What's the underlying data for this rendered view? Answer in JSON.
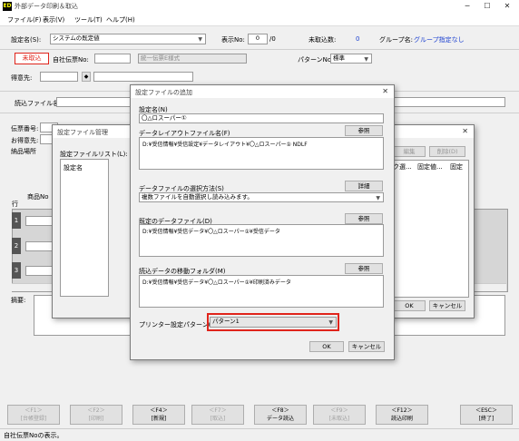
{
  "window": {
    "title": "外部データ印刷＆取込",
    "app_icon": "ED",
    "min": "─",
    "max": "☐",
    "close": "✕"
  },
  "menu": [
    "ファイル(F)",
    "表示(V)",
    "ツール(T)",
    "ヘルプ(H)"
  ],
  "main": {
    "setting_name_label": "設定名(S):",
    "setting_name_value": "システムの既定値",
    "display_no_label": "表示No:",
    "display_no_value": "0",
    "display_no_total": "/0",
    "unimported_label": "未取込数:",
    "unimported_value": "0",
    "group_label": "グループ名:",
    "group_value": "グループ指定なし",
    "status_badge": "未取込",
    "company_slip_label": "自社伝票No:",
    "slip_type_value": "統一伝票E様式",
    "pattern_label": "パターンNo:",
    "pattern_value": "標準",
    "customer_label": "得意先:",
    "customer_search_symbol": "◆",
    "read_file_label": "読込ファイル名:",
    "slip_no_label": "伝票番号:",
    "customer2_label": "お得意先:",
    "delivery_label": "納品場所",
    "row_label": "行",
    "product_label": "商品No",
    "rows": [
      "1",
      "2",
      "3"
    ],
    "summary_label": "摘要:"
  },
  "mgmt_dialog": {
    "title": "設定ファイル管理",
    "list_label": "設定ファイルリスト(L):",
    "column_header": "設定名",
    "edit_btn": "編集",
    "delete_btn": "削除(D)",
    "col1": "ーク選...",
    "col2": "固定値...",
    "col3": "固定",
    "ok_btn": "OK",
    "cancel_btn": "キャンセル",
    "close_icon": "✕"
  },
  "add_dialog": {
    "title": "設定ファイルの追加",
    "name_label": "設定名(N)",
    "name_value": "〇△ロスーパー①",
    "layout_label": "データレイアウトファイル名(F)",
    "layout_btn": "参照",
    "layout_value": "D:¥受信情報¥受信設定¥データレイアウト¥〇△ロスーパー① NDLF",
    "method_label": "データファイルの選択方法(S)",
    "method_btn": "詳細",
    "method_value": "複数ファイルを自動選択し読み込みます。",
    "default_file_label": "既定のデータファイル(D)",
    "default_file_btn": "参照",
    "default_file_value": "D:¥受信情報¥受信データ¥〇△ロスーパー①¥受信データ",
    "move_folder_label": "読込データの移動フォルダ(M)",
    "move_folder_btn": "参照",
    "move_folder_value": "D:¥受信情報¥受信データ¥〇△ロスーパー①¥印刷済みデータ",
    "printer_label": "プリンター設定パターン(P):",
    "printer_value": "パターン1",
    "ok_btn": "OK",
    "cancel_btn": "キャンセル",
    "close_icon": "✕",
    "highlight_color": "#e0241b"
  },
  "fkeys": [
    {
      "key": "＜F1＞",
      "label": "[台帳登録]",
      "enabled": false
    },
    {
      "key": "＜F2＞",
      "label": "[印刷]",
      "enabled": false
    },
    {
      "key": "＜F4＞",
      "label": "[新規]",
      "enabled": true
    },
    {
      "key": "＜F7＞",
      "label": "[取込]",
      "enabled": false
    },
    {
      "key": "＜F8＞",
      "label": "データ読込",
      "enabled": true
    },
    {
      "key": "＜F9＞",
      "label": "[未取込]",
      "enabled": false
    },
    {
      "key": "＜F12＞",
      "label": "読込印刷",
      "enabled": true
    },
    {
      "key": "＜ESC＞",
      "label": "[終了]",
      "enabled": true
    }
  ],
  "status_text": "自社伝票Noの表示。"
}
